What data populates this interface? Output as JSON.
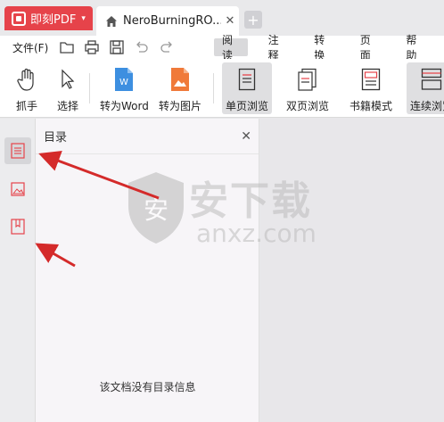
{
  "titlebar": {
    "app_name": "即刻PDF",
    "app_caret": "▾",
    "doc_tab_title": "NeroBurningRO...",
    "doc_tab_close": "✕",
    "new_tab": "+"
  },
  "menubar": {
    "file_label": "文件(F)",
    "tabs": [
      {
        "label": "阅读",
        "active": true
      },
      {
        "label": "注释",
        "active": false
      },
      {
        "label": "转换",
        "active": false
      },
      {
        "label": "页面",
        "active": false
      },
      {
        "label": "帮助",
        "active": false
      }
    ]
  },
  "toolbar": {
    "tools": [
      {
        "label": "抓手",
        "icon": "hand-icon"
      },
      {
        "label": "选择",
        "icon": "cursor-icon"
      },
      {
        "label": "转为Word",
        "icon": "word-icon"
      },
      {
        "label": "转为图片",
        "icon": "image-convert-icon"
      },
      {
        "label": "单页浏览",
        "icon": "single-page-icon",
        "active": true
      },
      {
        "label": "双页浏览",
        "icon": "double-page-icon"
      },
      {
        "label": "书籍模式",
        "icon": "book-mode-icon"
      },
      {
        "label": "连续浏览",
        "icon": "continuous-icon",
        "active": true
      }
    ]
  },
  "sidebar": {
    "buttons": [
      {
        "icon": "outline-icon",
        "active": true
      },
      {
        "icon": "thumbnail-icon",
        "active": false
      },
      {
        "icon": "bookmark-icon",
        "active": false
      }
    ]
  },
  "toc": {
    "title": "目录",
    "close": "✕",
    "empty_message": "该文档没有目录信息"
  },
  "watermark": {
    "text": "安下载",
    "subtext": "anxz.com"
  },
  "colors": {
    "brand": "#e6434a",
    "word_blue": "#3d8fe0",
    "image_orange": "#f07a3a",
    "arrow_red": "#d42a2a"
  }
}
